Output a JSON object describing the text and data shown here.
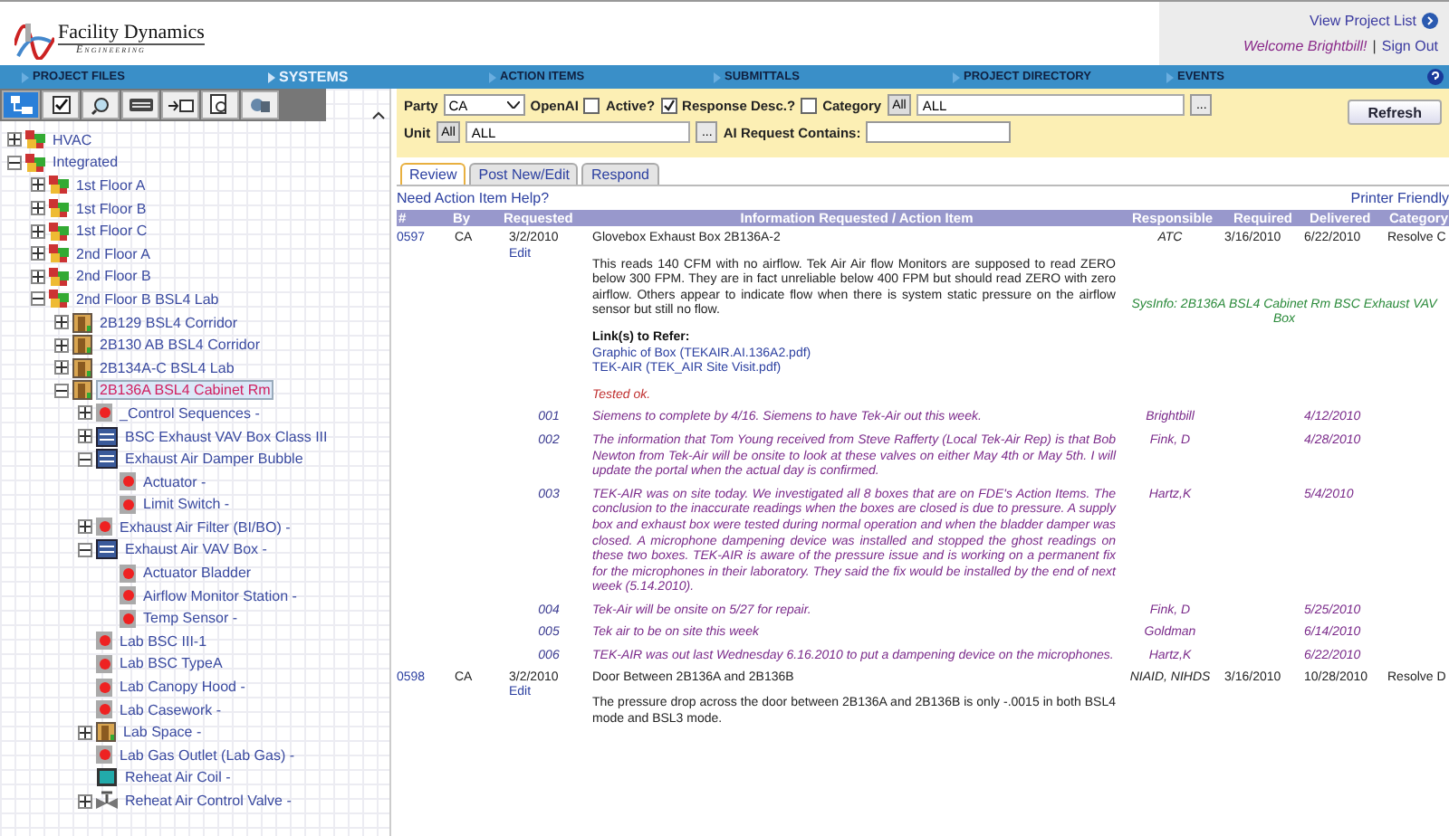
{
  "header": {
    "logo_title": "Facility Dynamics",
    "logo_subtitle": "Engineering",
    "view_project_list": "View Project List",
    "welcome": "Welcome Brightbill!",
    "separator": "|",
    "sign_out": "Sign Out"
  },
  "nav": [
    {
      "label": "PROJECT FILES",
      "selected": false
    },
    {
      "label": "SYSTEMS",
      "selected": true
    },
    {
      "label": "ACTION ITEMS",
      "selected": false
    },
    {
      "label": "SUBMITTALS",
      "selected": false
    },
    {
      "label": "PROJECT DIRECTORY",
      "selected": false
    },
    {
      "label": "EVENTS",
      "selected": false
    }
  ],
  "toolbar": [
    {
      "kind": "tree",
      "selected": true
    },
    {
      "kind": "check",
      "selected": false
    },
    {
      "kind": "search",
      "selected": false
    },
    {
      "kind": "keyboard",
      "selected": false
    },
    {
      "kind": "insert",
      "selected": false
    },
    {
      "kind": "preview",
      "selected": false
    },
    {
      "kind": "tools",
      "selected": false
    }
  ],
  "tree": [
    {
      "label": "HVAC",
      "kind": "folder",
      "expanded": false,
      "selected": false
    },
    {
      "label": "Integrated",
      "kind": "folder",
      "expanded": true,
      "selected": false,
      "children": [
        {
          "label": "1st Floor A",
          "kind": "folder",
          "expanded": false,
          "selected": false
        },
        {
          "label": "1st Floor B",
          "kind": "folder",
          "expanded": false,
          "selected": false
        },
        {
          "label": "1st Floor C",
          "kind": "folder",
          "expanded": false,
          "selected": false
        },
        {
          "label": "2nd Floor A",
          "kind": "folder",
          "expanded": false,
          "selected": false
        },
        {
          "label": "2nd Floor B",
          "kind": "folder",
          "expanded": false,
          "selected": false
        },
        {
          "label": "2nd Floor B BSL4 Lab",
          "kind": "folder",
          "expanded": true,
          "selected": false,
          "children": [
            {
              "label": "2B129 BSL4 Corridor",
              "kind": "room",
              "expanded": false,
              "selected": false
            },
            {
              "label": "2B130 AB BSL4 Corridor",
              "kind": "room",
              "expanded": false,
              "selected": false
            },
            {
              "label": "2B134A-C BSL4 Lab",
              "kind": "room",
              "expanded": false,
              "selected": false
            },
            {
              "label": "2B136A BSL4 Cabinet Rm",
              "kind": "room",
              "expanded": true,
              "selected": true,
              "children": [
                {
                  "label": "_Control Sequences -",
                  "kind": "point",
                  "expanded": false,
                  "selected": false
                },
                {
                  "label": "BSC Exhaust VAV Box Class III",
                  "kind": "box",
                  "expanded": false,
                  "selected": false
                },
                {
                  "label": "Exhaust Air Damper Bubble",
                  "kind": "box",
                  "expanded": true,
                  "selected": false,
                  "children": [
                    {
                      "label": "Actuator -",
                      "kind": "point",
                      "selected": false
                    },
                    {
                      "label": "Limit Switch -",
                      "kind": "point",
                      "selected": false
                    }
                  ]
                },
                {
                  "label": "Exhaust Air Filter (BI/BO) -",
                  "kind": "point",
                  "expanded": false,
                  "selected": false
                },
                {
                  "label": "Exhaust Air VAV Box -",
                  "kind": "box",
                  "expanded": true,
                  "selected": false,
                  "children": [
                    {
                      "label": "Actuator Bladder",
                      "kind": "point",
                      "selected": false
                    },
                    {
                      "label": "Airflow Monitor Station -",
                      "kind": "point",
                      "selected": false
                    },
                    {
                      "label": "Temp Sensor -",
                      "kind": "point",
                      "selected": false
                    }
                  ]
                },
                {
                  "label": "Lab BSC III-1",
                  "kind": "point",
                  "selected": false
                },
                {
                  "label": "Lab BSC TypeA",
                  "kind": "point",
                  "selected": false
                },
                {
                  "label": "Lab Canopy Hood -",
                  "kind": "point",
                  "selected": false
                },
                {
                  "label": "Lab Casework -",
                  "kind": "point",
                  "selected": false
                },
                {
                  "label": "Lab Space -",
                  "kind": "room",
                  "expanded": false,
                  "selected": false
                },
                {
                  "label": "Lab Gas Outlet (Lab Gas) -",
                  "kind": "point",
                  "selected": false
                },
                {
                  "label": "Reheat Air Coil -",
                  "kind": "coil",
                  "selected": false
                },
                {
                  "label": "Reheat Air Control Valve -",
                  "kind": "valve",
                  "expanded": false,
                  "selected": false
                }
              ]
            }
          ]
        }
      ]
    }
  ],
  "filters": {
    "party_label": "Party",
    "party_value": "CA",
    "openai_label": "OpenAI",
    "openai_checked": false,
    "active_label": "Active?",
    "active_checked": true,
    "response_label": "Response Desc.?",
    "response_checked": false,
    "category_label": "Category",
    "category_all": "All",
    "category_value": "ALL",
    "category_more": "...",
    "unit_label": "Unit",
    "unit_all": "All",
    "unit_value": "ALL",
    "unit_more": "...",
    "contains_label": "AI Request Contains:",
    "refresh": "Refresh"
  },
  "tabs": [
    {
      "label": "Review",
      "selected": true
    },
    {
      "label": "Post New/Edit",
      "selected": false
    },
    {
      "label": "Respond",
      "selected": false
    }
  ],
  "help_link": "Need Action Item Help?",
  "printer_link": "Printer Friendly",
  "table": {
    "columns": [
      "#",
      "By",
      "Requested",
      "Information Requested / Action Item",
      "Responsible",
      "Required",
      "Delivered",
      "Category"
    ],
    "rows": [
      {
        "number": "0597",
        "by": "CA",
        "requested": "3/2/2010",
        "edit": "Edit",
        "title": "Glovebox Exhaust Box 2B136A-2",
        "description": "This reads 140 CFM with no airflow. Tek Air Air flow Monitors are supposed to read ZERO below 300 FPM. They are in fact unreliable below 400 FPM but should read ZERO with zero airflow. Others appear to indicate flow when there is system static pressure on the airflow sensor but still no flow.",
        "links_label": "Link(s) to Refer:",
        "links": [
          "Graphic of Box (TEKAIR.AI.136A2.pdf)",
          "TEK-AIR (TEK_AIR Site Visit.pdf)"
        ],
        "note": "Tested ok.",
        "responsible": "ATC",
        "required": "3/16/2010",
        "delivered": "6/22/2010",
        "category": "Resolve C",
        "sysinfo": "SysInfo: 2B136A BSL4 Cabinet Rm BSC Exhaust VAV Box",
        "responses": [
          {
            "number": "001",
            "text": "Siemens to complete by 4/16. Siemens to have Tek-Air out this week.",
            "responsible": "Brightbill",
            "date": "4/12/2010"
          },
          {
            "number": "002",
            "text": "The information that Tom Young received from Steve Rafferty (Local Tek-Air Rep) is that Bob Newton from Tek-Air will be onsite to look at these valves on either May 4th or May 5th. I will update the portal when the actual day is confirmed.",
            "responsible": "Fink, D",
            "date": "4/28/2010"
          },
          {
            "number": "003",
            "text": "TEK-AIR was on site today. We investigated all 8 boxes that are on FDE's Action Items. The conclusion to the inaccurate readings when the boxes are closed is due to pressure. A supply box and exhaust box were tested during normal operation and when the bladder damper was closed. A microphone dampening device was installed and stopped the ghost readings on these two boxes. TEK-AIR is aware of the pressure issue and is working on a permanent fix for the microphones in their laboratory. They said the fix would be installed by the end of next week (5.14.2010).",
            "responsible": "Hartz,K",
            "date": "5/4/2010"
          },
          {
            "number": "004",
            "text": "Tek-Air will be onsite on 5/27 for repair.",
            "responsible": "Fink, D",
            "date": "5/25/2010"
          },
          {
            "number": "005",
            "text": "Tek air to be on site this week",
            "responsible": "Goldman",
            "date": "6/14/2010"
          },
          {
            "number": "006",
            "text": "TEK-AIR was out last Wednesday 6.16.2010 to put a dampening device on the microphones.",
            "responsible": "Hartz,K",
            "date": "6/22/2010"
          }
        ]
      },
      {
        "number": "0598",
        "by": "CA",
        "requested": "3/2/2010",
        "edit": "Edit",
        "title": "Door Between 2B136A and 2B136B",
        "description": "The pressure drop across the door between 2B136A and 2B136B is only -.0015 in both BSL4 mode and BSL3 mode.",
        "responsible": "NIAID, NIHDS",
        "required": "3/16/2010",
        "delivered": "10/28/2010",
        "category": "Resolve D",
        "responses": []
      }
    ]
  }
}
